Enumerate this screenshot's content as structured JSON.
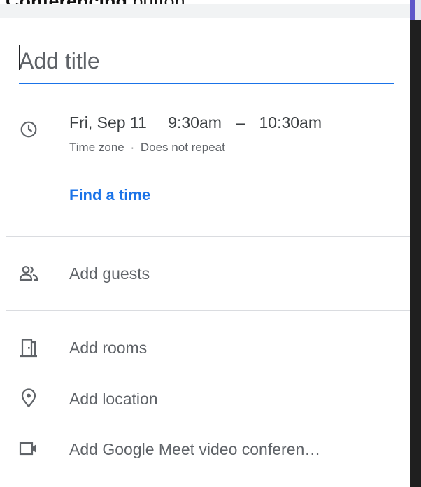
{
  "caption": {
    "bold_text": "Conferencing",
    "rest_text": " button."
  },
  "title_input": {
    "placeholder": "Add title",
    "value": ""
  },
  "datetime": {
    "date": "Fri, Sep 11",
    "start_time": "9:30am",
    "separator": "–",
    "end_time": "10:30am",
    "timezone_label": "Time zone",
    "bullet": "·",
    "repeat_label": "Does not repeat"
  },
  "find_time": {
    "label": "Find a time"
  },
  "guests": {
    "label": "Add guests",
    "icon": "people-icon"
  },
  "rooms": {
    "label": "Add rooms",
    "icon": "door-icon"
  },
  "location": {
    "label": "Add location",
    "icon": "location-pin-icon"
  },
  "conferencing": {
    "label": "Add Google Meet video conferen…",
    "icon": "video-camera-icon"
  },
  "colors": {
    "accent": "#1a73e8",
    "text_primary": "#3c4043",
    "text_secondary": "#5f6368",
    "divider": "#dadce0"
  }
}
